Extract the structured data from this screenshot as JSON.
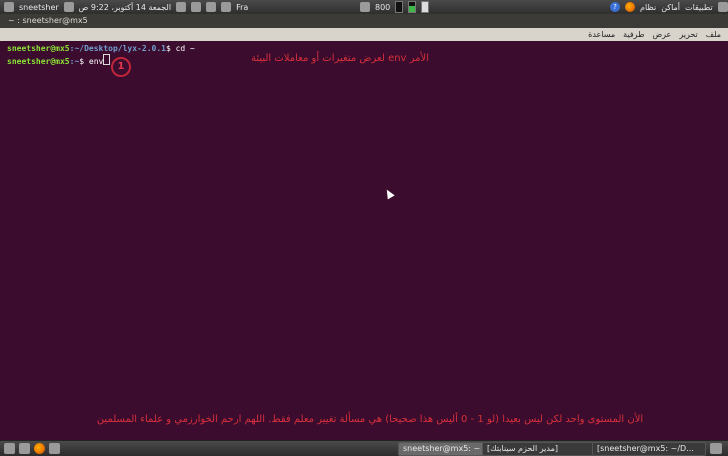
{
  "top_panel": {
    "username": "sneetsher",
    "clock": "الجمعة 14 أكتوبر، 9:22 ص",
    "network": "Fra",
    "cpu": "800",
    "menus": [
      "تطبيقات",
      "أماكن",
      "نظام"
    ]
  },
  "window": {
    "title": "~ : sneetsher@mx5",
    "menu": [
      "ملف",
      "تحرير",
      "عرض",
      "طرفية",
      "مساعدة"
    ]
  },
  "terminal": {
    "line1": {
      "user": "sneetsher@mx5",
      "path": ":~/Desktop/lyx-2.0.1",
      "cmd": "$ cd ~"
    },
    "line2": {
      "user": "sneetsher@mx5",
      "path": ":~",
      "cmd": "$ env"
    }
  },
  "annotations": {
    "marker": "1",
    "top_note": "الأمر env لعرض متغيرات أو معاملات البيئة",
    "bottom_note": "الأن المستوى واحد لكن ليس بعيدا (لو 1 - 0 أليس هذا صحيحا) هي مسألة تغيير معلم فقط. اللهم ارحم الخوارزمي و علماء المسلمين"
  },
  "taskbar": {
    "tasks": [
      "sneetsher@mx5: ~",
      "[مدير الحزم سينابتك]",
      "[sneetsher@mx5: ~/D..."
    ]
  }
}
